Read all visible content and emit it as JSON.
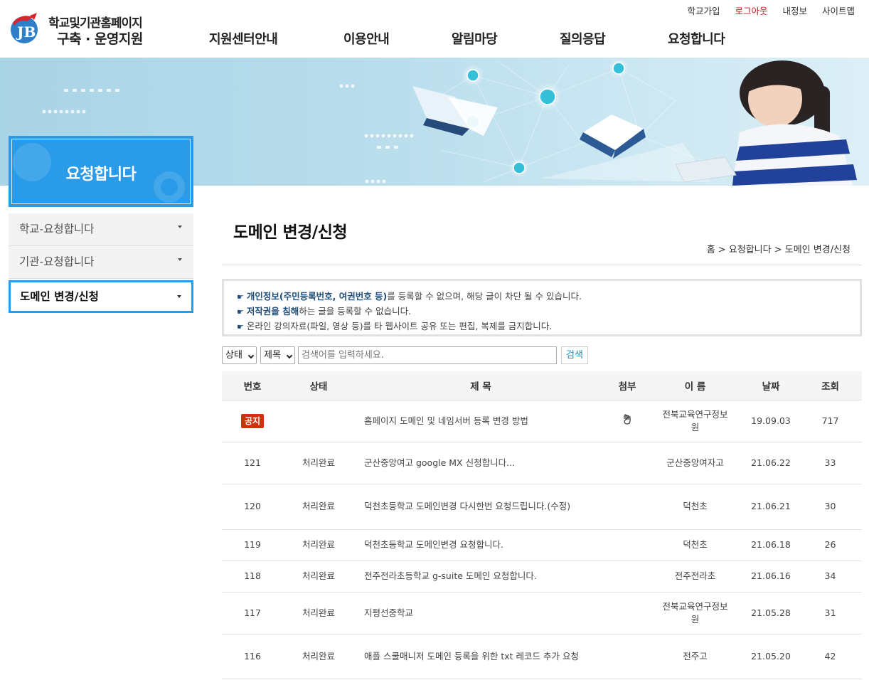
{
  "header": {
    "logo_line1": "학교및기관홈페이지",
    "logo_line2": "구축 · 운영지원",
    "util_links": [
      {
        "label": "학교가입",
        "red": false
      },
      {
        "label": "로그아웃",
        "red": true
      },
      {
        "label": "내정보",
        "red": false
      },
      {
        "label": "사이트맵",
        "red": false
      }
    ],
    "gnb": [
      "지원센터안내",
      "이용안내",
      "알림마당",
      "질의응답",
      "요청합니다"
    ]
  },
  "sidebar": {
    "title": "요청합니다",
    "items": [
      {
        "label": "학교-요청합니다"
      },
      {
        "label": "기관-요청합니다"
      },
      {
        "label": "도메인 변경/신청"
      }
    ]
  },
  "content": {
    "page_title": "도메인 변경/신청",
    "breadcrumb": "홈 > 요청합니다 > 도메인 변경/신청",
    "notices": [
      {
        "bold": "개인정보(주민등록번호, 여권번호 등)",
        "rest": "를 등록할 수 없으며, 해당 글이 차단 될 수 있습니다."
      },
      {
        "bold": "저작권을 침해",
        "rest": "하는 글을 등록할 수 없습니다."
      },
      {
        "bold": "",
        "rest": "온라인 강의자료(파일, 영상 등)를 타 웹사이트 공유 또는 편집, 복제를 금지합니다."
      }
    ],
    "search": {
      "status_select": "상태",
      "field_select": "제목",
      "placeholder": "검색어를 입력하세요.",
      "button": "검색"
    }
  },
  "table": {
    "headers": [
      "번호",
      "상태",
      "제 목",
      "첨부",
      "이 름",
      "날짜",
      "조회"
    ],
    "notice_badge": "공지",
    "rows": [
      {
        "num": "",
        "notice": true,
        "status": "",
        "subject": "홈페이지 도메인 및 네임서버 등록 변경 방법",
        "attach": true,
        "name": "전북교육연구정보원",
        "date": "19.09.03",
        "views": "717"
      },
      {
        "num": "121",
        "notice": false,
        "status": "처리완료",
        "subject": "군산중앙여고 google MX 신청합니다...",
        "attach": false,
        "name": "군산중앙여자고",
        "date": "21.06.22",
        "views": "33"
      },
      {
        "num": "120",
        "notice": false,
        "status": "처리완료",
        "subject": "덕천초등학교 도메인변경 다시한번 요청드립니다.(수정)",
        "attach": false,
        "name": "덕천초",
        "date": "21.06.21",
        "views": "30"
      },
      {
        "num": "119",
        "notice": false,
        "status": "처리완료",
        "subject": "덕천초등학교 도메인변경 요청합니다.",
        "attach": false,
        "name": "덕천초",
        "date": "21.06.18",
        "views": "26"
      },
      {
        "num": "118",
        "notice": false,
        "status": "처리완료",
        "subject": "전주전라초등학교 g-suite 도메인 요청합니다.",
        "attach": false,
        "name": "전주전라초",
        "date": "21.06.16",
        "views": "34"
      },
      {
        "num": "117",
        "notice": false,
        "status": "처리완료",
        "subject": "지평선중학교",
        "attach": false,
        "name": "전북교육연구정보원",
        "date": "21.05.28",
        "views": "31"
      },
      {
        "num": "116",
        "notice": false,
        "status": "처리완료",
        "subject": "애플 스쿨매니저 도메인 등록을 위한 txt 레코드 추가 요청",
        "attach": false,
        "name": "전주고",
        "date": "21.05.20",
        "views": "42"
      }
    ]
  }
}
